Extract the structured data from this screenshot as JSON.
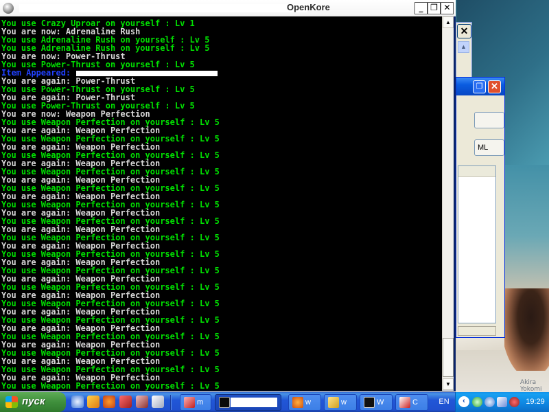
{
  "window": {
    "title_suffix": "enKore",
    "title_app": "OpenKore",
    "controls": {
      "minimize": "_",
      "maximize": "❐",
      "close": "✕"
    }
  },
  "console": {
    "lines": [
      {
        "text": "You use Crazy Uproar on yourself : Lv 1",
        "color": "green"
      },
      {
        "text": "You are now: Adrenaline Rush",
        "color": "white"
      },
      {
        "text": "You use Adrenaline Rush on yourself : Lv 5",
        "color": "green"
      },
      {
        "text": "You use Adrenaline Rush on yourself : Lv 5",
        "color": "green"
      },
      {
        "text": "You are now: Power-Thrust",
        "color": "white"
      },
      {
        "text": "You use Power-Thrust on yourself : Lv 5",
        "color": "green"
      },
      {
        "text": "Item Appeared:",
        "color": "blue",
        "redacted": true
      },
      {
        "text": "You are again: Power-Thrust",
        "color": "white"
      },
      {
        "text": "You use Power-Thrust on yourself : Lv 5",
        "color": "green"
      },
      {
        "text": "You are again: Power-Thrust",
        "color": "white"
      },
      {
        "text": "You use Power-Thrust on yourself : Lv 5",
        "color": "green"
      },
      {
        "text": "You are now: Weapon Perfection",
        "color": "white"
      },
      {
        "text": "You use Weapon Perfection on yourself : Lv 5",
        "color": "green"
      },
      {
        "text": "You are again: Weapon Perfection",
        "color": "white"
      },
      {
        "text": "You use Weapon Perfection on yourself : Lv 5",
        "color": "green"
      },
      {
        "text": "You are again: Weapon Perfection",
        "color": "white"
      },
      {
        "text": "You use Weapon Perfection on yourself : Lv 5",
        "color": "green"
      },
      {
        "text": "You are again: Weapon Perfection",
        "color": "white"
      },
      {
        "text": "You use Weapon Perfection on yourself : Lv 5",
        "color": "green"
      },
      {
        "text": "You are again: Weapon Perfection",
        "color": "white"
      },
      {
        "text": "You use Weapon Perfection on yourself : Lv 5",
        "color": "green"
      },
      {
        "text": "You are again: Weapon Perfection",
        "color": "white"
      },
      {
        "text": "You use Weapon Perfection on yourself : Lv 5",
        "color": "green"
      },
      {
        "text": "You are again: Weapon Perfection",
        "color": "white"
      },
      {
        "text": "You use Weapon Perfection on yourself : Lv 5",
        "color": "green"
      },
      {
        "text": "You are again: Weapon Perfection",
        "color": "white"
      },
      {
        "text": "You use Weapon Perfection on yourself : Lv 5",
        "color": "green"
      },
      {
        "text": "You are again: Weapon Perfection",
        "color": "white"
      },
      {
        "text": "You use Weapon Perfection on yourself : Lv 5",
        "color": "green"
      },
      {
        "text": "You are again: Weapon Perfection",
        "color": "white"
      },
      {
        "text": "You use Weapon Perfection on yourself : Lv 5",
        "color": "green"
      },
      {
        "text": "You are again: Weapon Perfection",
        "color": "white"
      },
      {
        "text": "You use Weapon Perfection on yourself : Lv 5",
        "color": "green"
      },
      {
        "text": "You are again: Weapon Perfection",
        "color": "white"
      },
      {
        "text": "You use Weapon Perfection on yourself : Lv 5",
        "color": "green"
      },
      {
        "text": "You are again: Weapon Perfection",
        "color": "white"
      },
      {
        "text": "You use Weapon Perfection on yourself : Lv 5",
        "color": "green"
      },
      {
        "text": "You are again: Weapon Perfection",
        "color": "white"
      },
      {
        "text": "You use Weapon Perfection on yourself : Lv 5",
        "color": "green"
      },
      {
        "text": "You are again: Weapon Perfection",
        "color": "white"
      },
      {
        "text": "You use Weapon Perfection on yourself : Lv 5",
        "color": "green"
      },
      {
        "text": "You are again: Weapon Perfection",
        "color": "white"
      },
      {
        "text": "You use Weapon Perfection on yourself : Lv 5",
        "color": "green"
      },
      {
        "text": "You are again: Weapon Perfection",
        "color": "white"
      },
      {
        "text": "You use Weapon Perfection on yourself : Lv 5",
        "color": "green"
      }
    ],
    "colors": {
      "green": "#00e000",
      "white": "#d8d8d8",
      "blue": "#2040ff",
      "background": "#000000"
    }
  },
  "background_dialog": {
    "button_2_label": "ML"
  },
  "taskbar": {
    "start_label": "пуск",
    "quick_launch": [
      "ie-icon",
      "winamp-icon",
      "firefox-icon",
      "media-icon",
      "game-icon",
      "notepad-icon"
    ],
    "tasks": [
      {
        "label": "m",
        "icon": "task-app-icon"
      },
      {
        "label": "",
        "icon": "console-icon",
        "active": true
      },
      {
        "label": "w",
        "icon": "firefox-icon"
      },
      {
        "label": "w",
        "icon": "folder-icon"
      },
      {
        "label": "W",
        "icon": "console-icon"
      },
      {
        "label": "C",
        "icon": "app-icon"
      }
    ],
    "language": "EN",
    "clock": "19:29",
    "tray_icons": [
      "network-icon",
      "antivirus-icon",
      "volume-icon",
      "app-tray-icon"
    ]
  },
  "wallpaper": {
    "watermark": "Akira Yokomi"
  }
}
